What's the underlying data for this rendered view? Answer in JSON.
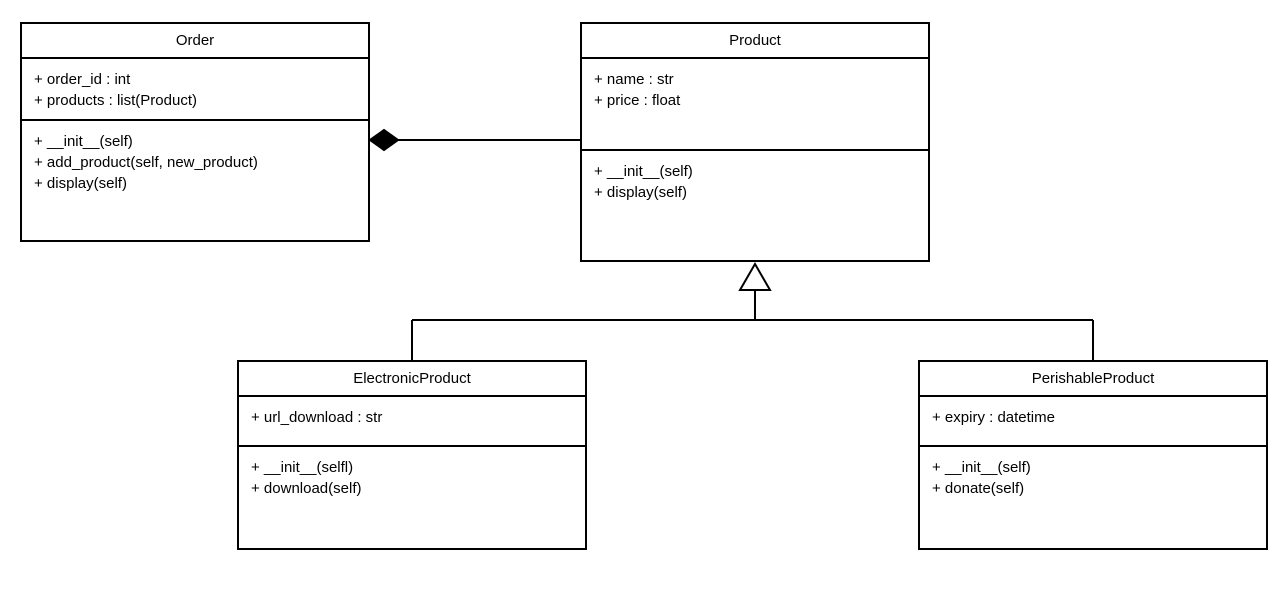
{
  "classes": {
    "order": {
      "title": "Order",
      "attributes": [
        "+ order_id : int",
        "+ products : list(Product)"
      ],
      "methods": [
        "+ __init__(self)",
        "+ add_product(self, new_product)",
        "+ display(self)"
      ]
    },
    "product": {
      "title": "Product",
      "attributes": [
        "+ name : str",
        "+ price : float"
      ],
      "methods": [
        "+ __init__(self)",
        "+ display(self)"
      ]
    },
    "electronic": {
      "title": "ElectronicProduct",
      "attributes": [
        "+ url_download : str"
      ],
      "methods": [
        "+ __init__(selfl)",
        "+ download(self)"
      ]
    },
    "perishable": {
      "title": "PerishableProduct",
      "attributes": [
        "+ expiry : datetime"
      ],
      "methods": [
        "+ __init__(self)",
        "+ donate(self)"
      ]
    }
  },
  "relations": {
    "order_product": "composition",
    "electronic_product": "inheritance",
    "perishable_product": "inheritance"
  }
}
